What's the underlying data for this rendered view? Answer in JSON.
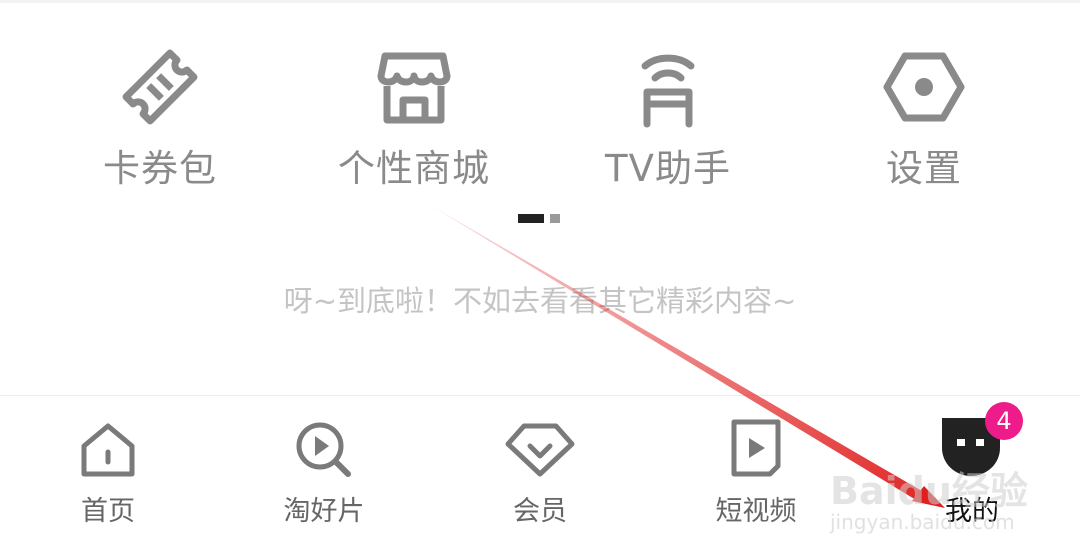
{
  "tools": [
    {
      "label": "卡券包",
      "icon": "ticket-icon"
    },
    {
      "label": "个性商城",
      "icon": "store-icon"
    },
    {
      "label": "TV助手",
      "icon": "tv-assistant-icon"
    },
    {
      "label": "设置",
      "icon": "settings-hexagon-icon"
    }
  ],
  "end_message": "呀~到底啦！不如去看看其它精彩内容~",
  "tabs": [
    {
      "label": "首页",
      "icon": "home-icon"
    },
    {
      "label": "淘好片",
      "icon": "search-play-icon"
    },
    {
      "label": "会员",
      "icon": "diamond-icon"
    },
    {
      "label": "短视频",
      "icon": "video-play-icon"
    },
    {
      "label": "我的",
      "icon": "profile-avatar-icon"
    }
  ],
  "profile_badge": "4",
  "watermark": {
    "brand": "Baidu经验",
    "url": "jingyan.baidu.com"
  },
  "colors": {
    "icon_gray": "#8a8a8a",
    "badge": "#ee1c8a",
    "annotation_arrow": "#e02020"
  }
}
